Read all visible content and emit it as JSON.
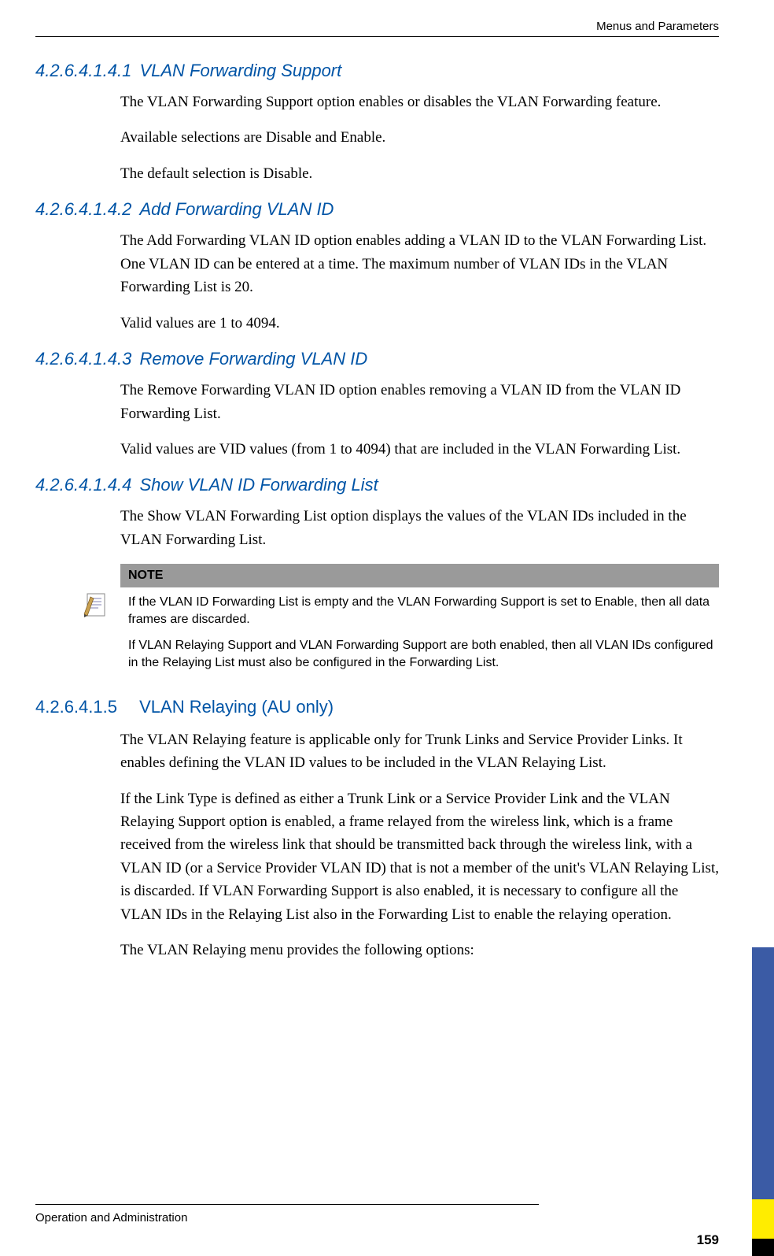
{
  "header": "Menus and Parameters",
  "sections": [
    {
      "num": "4.2.6.4.1.4.1",
      "title": "VLAN Forwarding Support",
      "style": "italic",
      "paras": [
        "The VLAN Forwarding Support option enables or disables the VLAN Forwarding feature.",
        "Available selections are Disable and Enable.",
        "The default selection is Disable."
      ]
    },
    {
      "num": "4.2.6.4.1.4.2",
      "title": "Add Forwarding VLAN ID",
      "style": "italic",
      "paras": [
        "The Add Forwarding VLAN ID option enables adding a VLAN ID to the VLAN Forwarding List. One VLAN ID can be entered at a time. The maximum number of VLAN IDs in the VLAN Forwarding List is 20.",
        "Valid values are 1 to 4094."
      ]
    },
    {
      "num": "4.2.6.4.1.4.3",
      "title": "Remove Forwarding VLAN ID",
      "style": "italic",
      "paras": [
        "The Remove Forwarding VLAN ID option enables removing a VLAN ID from the VLAN ID Forwarding List.",
        "Valid values are VID values (from 1 to 4094) that are included in the VLAN Forwarding List."
      ]
    },
    {
      "num": "4.2.6.4.1.4.4",
      "title": "Show VLAN ID Forwarding List",
      "style": "italic",
      "paras": [
        "The Show VLAN Forwarding List option displays the values of the VLAN IDs included in the VLAN Forwarding List."
      ]
    }
  ],
  "note": {
    "header": "NOTE",
    "paras": [
      "If the VLAN ID Forwarding List is empty and the VLAN Forwarding Support is set to Enable, then all data frames are discarded.",
      "If VLAN Relaying Support and VLAN Forwarding Support are both enabled, then all VLAN IDs configured in the Relaying List must also be configured in the Forwarding List."
    ]
  },
  "section5": {
    "num": "4.2.6.4.1.5",
    "title": "VLAN Relaying (AU only)",
    "paras": [
      "The VLAN Relaying feature is applicable only for Trunk Links and Service Provider Links. It enables defining the VLAN ID values to be included in the VLAN Relaying List.",
      "If the Link Type is defined as either a Trunk Link or a Service Provider Link and the VLAN Relaying Support option is enabled, a frame relayed from the wireless link, which is a frame received from the wireless link that should be transmitted back through the wireless link, with a VLAN ID (or a Service Provider VLAN ID) that is not a member of the unit's VLAN Relaying List, is discarded. If VLAN Forwarding Support is also enabled, it is necessary to configure all the VLAN IDs in the Relaying List also in the Forwarding List to enable the relaying operation.",
      "The VLAN Relaying menu provides the following options:"
    ]
  },
  "footer": "Operation and Administration",
  "pageNum": "159"
}
